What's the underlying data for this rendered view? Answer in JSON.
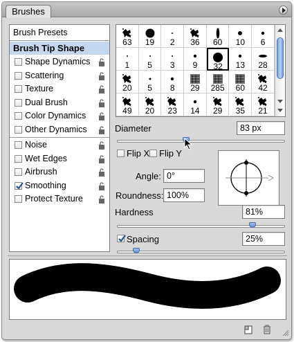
{
  "tab": {
    "label": "Brushes"
  },
  "options": {
    "presets": "Brush Presets",
    "tip_shape": "Brush Tip Shape",
    "items_a": [
      {
        "label": "Shape Dynamics",
        "checked": false
      },
      {
        "label": "Scattering",
        "checked": false
      },
      {
        "label": "Texture",
        "checked": false
      },
      {
        "label": "Dual Brush",
        "checked": false
      },
      {
        "label": "Color Dynamics",
        "checked": false
      },
      {
        "label": "Other Dynamics",
        "checked": false
      }
    ],
    "items_b": [
      {
        "label": "Noise",
        "checked": false
      },
      {
        "label": "Wet Edges",
        "checked": false
      },
      {
        "label": "Airbrush",
        "checked": false
      },
      {
        "label": "Smoothing",
        "checked": true
      },
      {
        "label": "Protect Texture",
        "checked": false
      }
    ]
  },
  "brush_sizes": [
    [
      "63",
      "19",
      "2",
      "36",
      "60",
      "10",
      "6"
    ],
    [
      "1",
      "5",
      "3",
      "9",
      "32",
      "13",
      "28"
    ],
    [
      "20",
      "5",
      "8",
      "29",
      "285",
      "60",
      "42"
    ],
    [
      "49",
      "20",
      "23",
      "14",
      "29",
      "35",
      "21"
    ]
  ],
  "diameter": {
    "label": "Diameter",
    "value": "83 px",
    "level": 0.41
  },
  "flip_x": {
    "label": "Flip X",
    "checked": false
  },
  "flip_y": {
    "label": "Flip Y",
    "checked": false
  },
  "angle": {
    "label": "Angle:",
    "value": "0°"
  },
  "roundness": {
    "label": "Roundness:",
    "value": "100%"
  },
  "hardness": {
    "label": "Hardness",
    "value": "81%",
    "level": 0.81
  },
  "spacing": {
    "label": "Spacing",
    "value": "25%",
    "checked": true,
    "level": 0.11
  },
  "accent": "#5b8ad0",
  "selection_color": "#c5d7ef"
}
